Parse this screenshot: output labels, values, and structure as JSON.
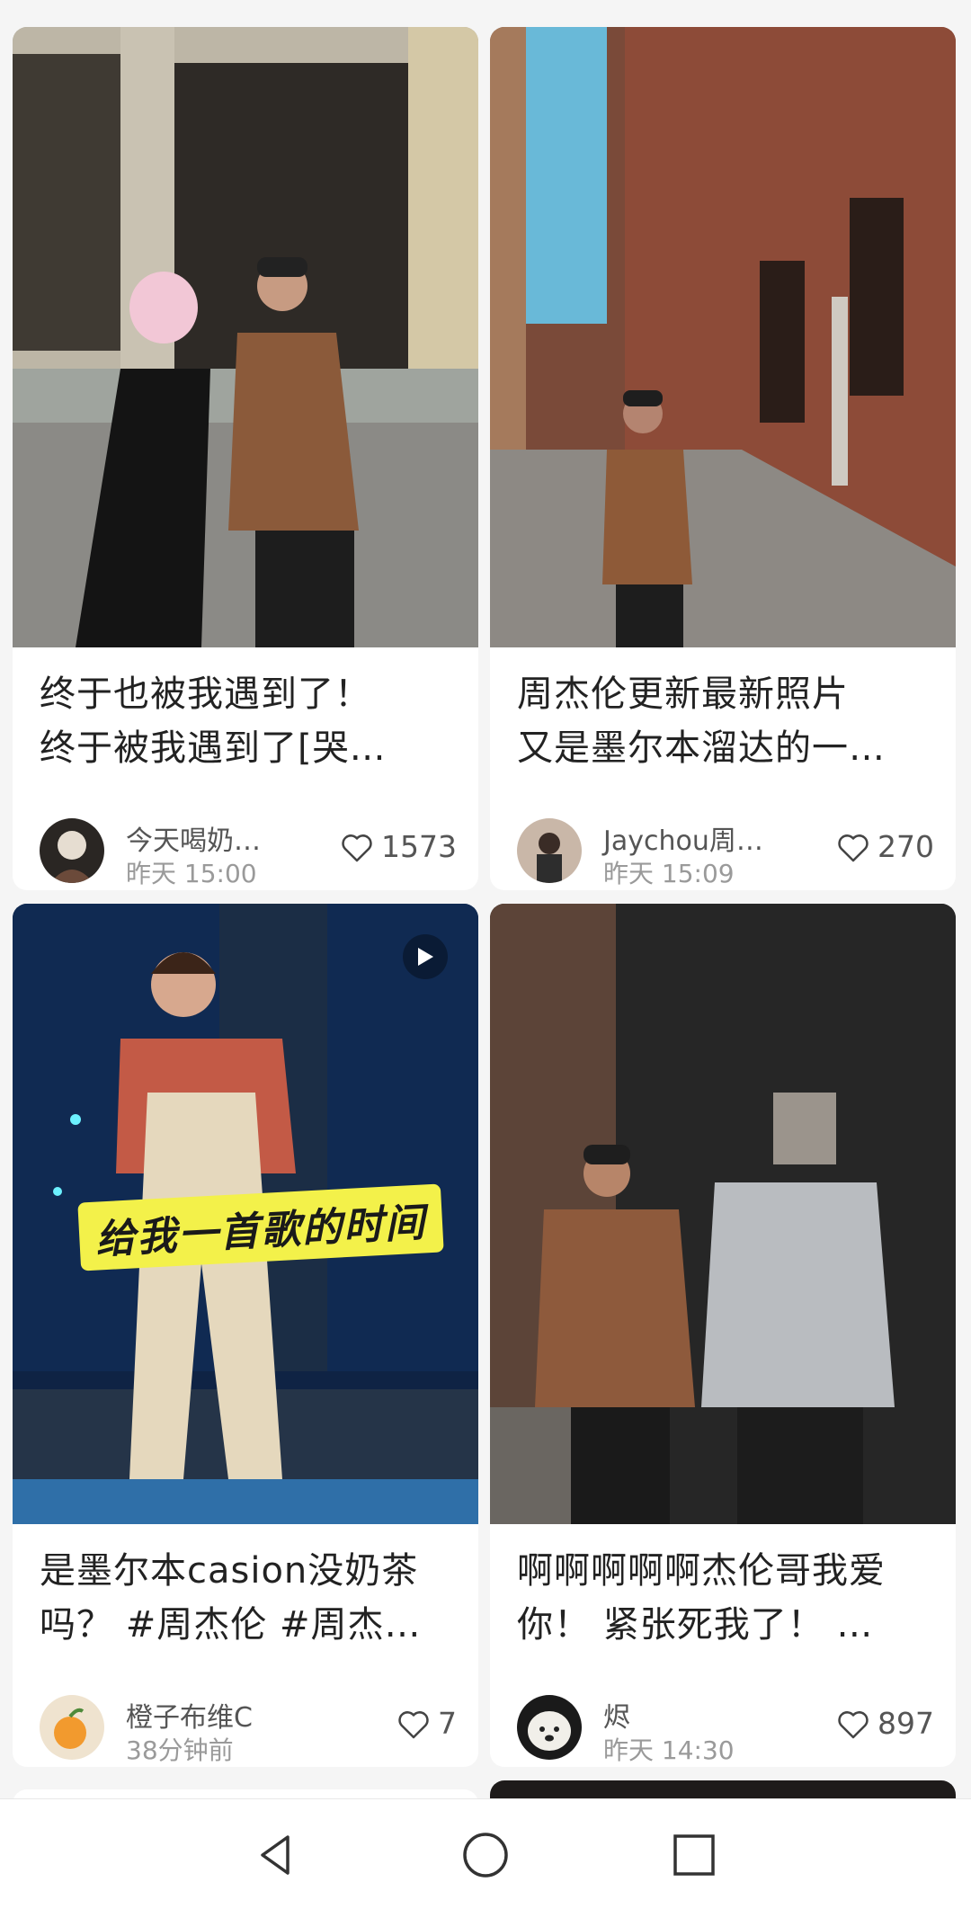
{
  "colors": {
    "background": "#f5f5f5",
    "card": "#ffffff",
    "text": "#222222",
    "muted": "#9a9a9a"
  },
  "cards": [
    {
      "title_line1": "终于也被我遇到了！",
      "title_line2": "终于被我遇到了[哭…",
      "author": "今天喝奶…",
      "time": "昨天 15:00",
      "likes": "1573",
      "is_video": false
    },
    {
      "title_line1": "周杰伦更新最新照片",
      "title_line2": "又是墨尔本溜达的一…",
      "author": "Jaychou周…",
      "time": "昨天 15:09",
      "likes": "270",
      "is_video": false
    },
    {
      "title_line1": "是墨尔本casion没奶茶",
      "title_line2": "吗？ #周杰伦  #周杰…",
      "author": "橙子布维C",
      "time": "38分钟前",
      "likes": "7",
      "is_video": true,
      "video_caption": "给我一首歌的时间"
    },
    {
      "title_line1": "啊啊啊啊啊杰伦哥我爱",
      "title_line2": "你！ 紧张死我了！ …",
      "author": "烬",
      "time": "昨天 14:30",
      "likes": "897",
      "is_video": false
    }
  ],
  "navbar": {
    "icons": [
      "back-icon",
      "home-icon",
      "recents-icon"
    ]
  }
}
